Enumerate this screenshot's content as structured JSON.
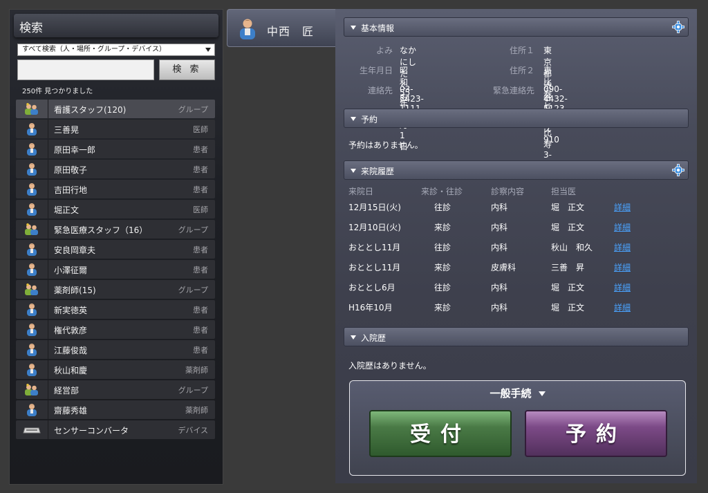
{
  "search": {
    "title": "検索",
    "scope": "すべて検索（人・場所・グループ・デバイス）",
    "button": "検 索",
    "result_count": "250件 見つかりました",
    "results": [
      {
        "icon": "group-icon",
        "name": "看護スタッフ(120)",
        "type": "グループ"
      },
      {
        "icon": "person-icon",
        "name": "三善晃",
        "type": "医師"
      },
      {
        "icon": "person-icon",
        "name": "原田幸一郎",
        "type": "患者"
      },
      {
        "icon": "person-icon",
        "name": "原田敬子",
        "type": "患者"
      },
      {
        "icon": "person-icon",
        "name": "吉田行地",
        "type": "患者"
      },
      {
        "icon": "person-icon",
        "name": "堀正文",
        "type": "医師"
      },
      {
        "icon": "group-icon",
        "name": "緊急医療スタッフ（16）",
        "type": "グループ"
      },
      {
        "icon": "person-icon",
        "name": "安良岡章夫",
        "type": "患者"
      },
      {
        "icon": "person-icon",
        "name": "小澤征爾",
        "type": "患者"
      },
      {
        "icon": "group-icon",
        "name": "薬剤師(15)",
        "type": "グループ"
      },
      {
        "icon": "person-icon",
        "name": "新実徳英",
        "type": "患者"
      },
      {
        "icon": "person-icon",
        "name": "権代敦彦",
        "type": "患者"
      },
      {
        "icon": "person-icon",
        "name": "江藤俊哉",
        "type": "患者"
      },
      {
        "icon": "person-icon",
        "name": "秋山和慶",
        "type": "薬剤師"
      },
      {
        "icon": "group-icon",
        "name": "経営部",
        "type": "グループ"
      },
      {
        "icon": "person-icon",
        "name": "齋藤秀雄",
        "type": "薬剤師"
      },
      {
        "icon": "device-icon",
        "name": "センサーコンバータ",
        "type": "デバイス"
      }
    ]
  },
  "patient": {
    "name": "中西　匠"
  },
  "basic_info": {
    "title": "基本情報",
    "yomi_label": "よみ",
    "yomi": "なかにし　たくみ",
    "birth_label": "生年月日",
    "birth": "昭和55年4月1日",
    "contact_label": "連絡先",
    "contact": "03-5423-1111",
    "addr1_label": "住所１",
    "addr1": "東京都渋谷区恵比寿3-19-25",
    "addr2_label": "住所２",
    "addr2": "恵比寿ヒルズ910",
    "emergency_label": "緊急連絡先",
    "emergency": "090-4432-1123"
  },
  "reservation": {
    "title": "予約",
    "note": "予約はありません。"
  },
  "visits": {
    "title": "来院履歴",
    "headers": [
      "来院日",
      "来診・往診",
      "診察内容",
      "担当医"
    ],
    "link": "詳細",
    "rows": [
      {
        "date": "12月15日(火)",
        "kind": "往診",
        "content": "内科",
        "doctor": "堀　正文"
      },
      {
        "date": "12月10日(火)",
        "kind": "来診",
        "content": "内科",
        "doctor": "堀　正文"
      },
      {
        "date": "おととし11月",
        "kind": "往診",
        "content": "内科",
        "doctor": "秋山　和久"
      },
      {
        "date": "おととし11月",
        "kind": "来診",
        "content": "皮膚科",
        "doctor": "三善　昇"
      },
      {
        "date": "おととし6月",
        "kind": "往診",
        "content": "内科",
        "doctor": "堀　正文"
      },
      {
        "date": "H16年10月",
        "kind": "来診",
        "content": "内科",
        "doctor": "堀　正文"
      }
    ]
  },
  "admission": {
    "title": "入院歴",
    "note": "入院歴はありません。"
  },
  "procedures": {
    "title": "一般手続",
    "reception": "受付",
    "appointment": "予約"
  }
}
